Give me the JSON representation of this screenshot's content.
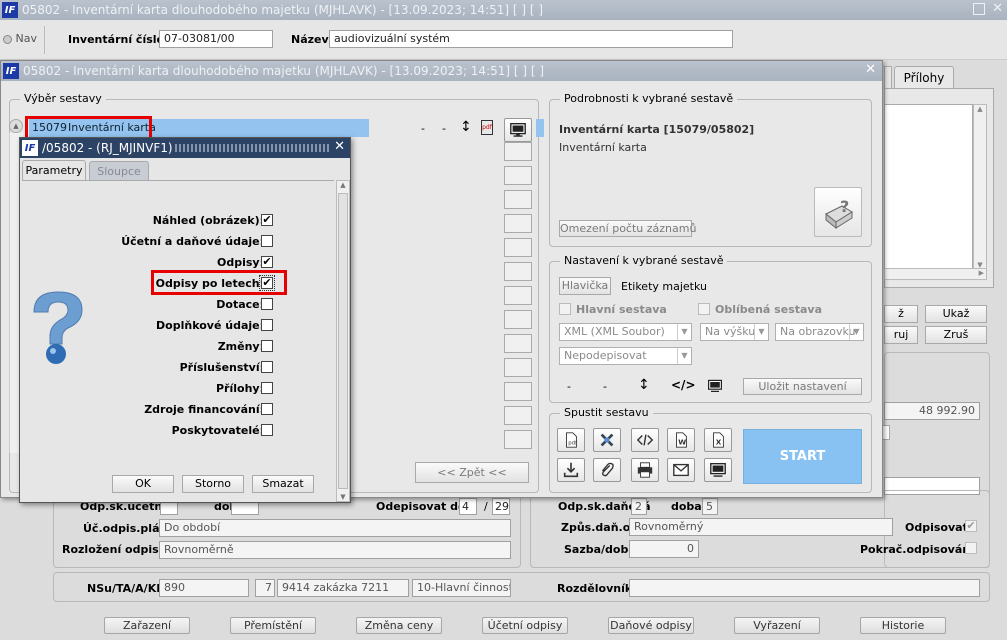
{
  "main": {
    "title": "05802 - Inventární karta dlouhodobého majetku (MJHLAVK) - [13.09.2023; 14:51]  [ ]  [ ]",
    "nav_label": "Nav",
    "inv_cislo_label": "Inventární číslo",
    "inv_cislo_value": "07-03081/00",
    "nazev_label": "Název",
    "nazev_value": "audiovizuální systém",
    "tab_prilohy": "Přílohy",
    "btn_ukaz": "Ukaž",
    "btn_z": "ž",
    "btn_ruj": "ruj",
    "btn_zrus": "Zruš",
    "amount": "48 992.90",
    "odp_sk_ucetni_label": "Odp.sk.účetní",
    "doba_label1": "doba",
    "odepisovat_do_label": "Odepisovat do",
    "odepisovat_do_m": "4",
    "odepisovat_do_slash": "/",
    "odepisovat_do_y": "29",
    "uc_odpis_plan_label": "Úč.odpis.plán",
    "uc_odpis_plan_value": "Do období",
    "rozlozeni_label": "Rozložení odpisů",
    "rozlozeni_value": "Rovnoměrně",
    "odp_sk_danova_label": "Odp.sk.daňová",
    "odp_sk_danova_value": "2",
    "doba_label2": "doba",
    "doba_value2": "5",
    "zpus_dan_label": "Způs.daň.odp.",
    "zpus_dan_value": "Rovnoměrný",
    "odpisovat_label": "Odpisovat",
    "sazba_label": "Sazba/doba",
    "sazba_value": "0",
    "pokrac_label": "Pokrač.odpisování",
    "nsu_label": "NSu/TA/A/KP",
    "nsu_v1": "890",
    "nsu_v2": "7",
    "nsu_v3": "9414 zakázka 7211",
    "nsu_v4": "10-Hlavní činnost",
    "rozdelovnik_label": "Rozdělovník",
    "bottom_buttons": [
      "Zařazení",
      "Přemístění",
      "Změna ceny",
      "Účetní odpisy",
      "Daňové odpisy",
      "Vyřazení",
      "Historie"
    ]
  },
  "report": {
    "title": "05802 - Inventární karta dlouhodobého majetku (MJHLAVK) - [13.09.2023; 14:51]  [ ]  [ ]",
    "vyber_label": "Výběr sestavy",
    "selected_code": "15079",
    "selected_name": "Inventární karta",
    "dash1": "-",
    "dash2": "-",
    "zpet_label": "<< Zpět <<",
    "podrobnosti_label": "Podrobnosti k vybrané sestavě",
    "detail_title": "Inventární karta [15079/05802]",
    "detail_sub": "Inventární karta",
    "omezeni_label": "Omezení počtu záznamů",
    "nastaveni_label": "Nastavení k vybrané sestavě",
    "hlavicka_label": "Hlavička",
    "etikety_label": "Etikety majetku",
    "hlavni_sestava_label": "Hlavní sestava",
    "oblibena_label": "Oblíbená sestava",
    "format_value": "XML (XML Soubor)",
    "orientace_value": "Na výšku",
    "vystup_value": "Na obrazovku",
    "podpis_value": "Nepodepisovat",
    "dash3": "-",
    "dash4": "-",
    "ulozit_label": "Uložit nastavení",
    "spustit_label": "Spustit sestavu",
    "start_label": "START"
  },
  "param": {
    "title": "/05802 - (RJ_MJINVF1)",
    "tab_parametry": "Parametry",
    "tab_sloupce": "Sloupce",
    "items": [
      {
        "label": "Náhled (obrázek):",
        "checked": "✔"
      },
      {
        "label": "Účetní a daňové údaje:",
        "checked": ""
      },
      {
        "label": "Odpisy:",
        "checked": "✔"
      },
      {
        "label": "Odpisy po letech:",
        "checked": "✔"
      },
      {
        "label": "Dotace:",
        "checked": ""
      },
      {
        "label": "Doplňkové údaje:",
        "checked": ""
      },
      {
        "label": "Změny:",
        "checked": ""
      },
      {
        "label": "Příslušenství:",
        "checked": ""
      },
      {
        "label": "Přílohy:",
        "checked": ""
      },
      {
        "label": "Zdroje financování:",
        "checked": ""
      },
      {
        "label": "Poskytovatelé:",
        "checked": ""
      }
    ],
    "ok_label": "OK",
    "storno_label": "Storno",
    "smazat_label": "Smazat"
  },
  "icons": [
    "sort-icon",
    "pdf-icon",
    "monitor-icon",
    "close-icon",
    "restore-icon",
    "help-icon",
    "printer-help-icon",
    "html-icon",
    "word-icon",
    "excel-icon",
    "download-icon",
    "attach-icon",
    "print-icon",
    "mail-icon"
  ],
  "colors": {
    "highlight": "#e60000",
    "selection": "#93c3ee",
    "start": "#88c2f2",
    "title_blue": "#1b3aa6"
  }
}
